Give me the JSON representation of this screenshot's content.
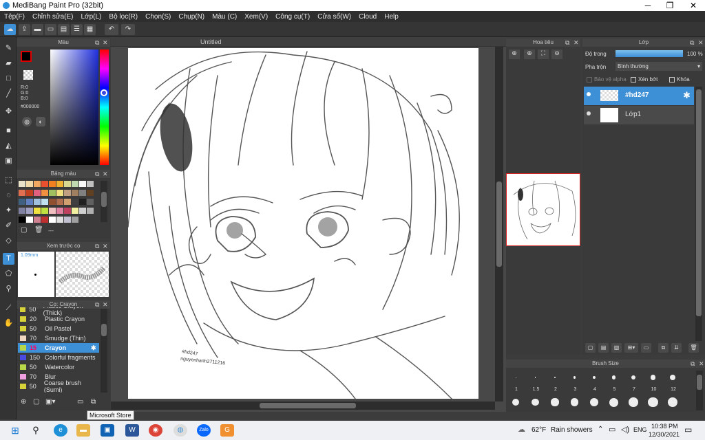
{
  "window": {
    "title": "MediBang Paint Pro (32bit)",
    "minimize": "─",
    "maximize": "❐",
    "close": "✕"
  },
  "menu": [
    "Tệp(F)",
    "Chỉnh sửa(E)",
    "Lớp(L)",
    "Bộ lọc(R)",
    "Chọn(S)",
    "Chụp(N)",
    "Màu (C)",
    "Xem(V)",
    "Công cụ(T)",
    "Cửa sổ(W)",
    "Cloud",
    "Help"
  ],
  "color_panel": {
    "title": "Màu",
    "r": "R:0",
    "g": "G:0",
    "b": "B:0",
    "hex": "#000000",
    "primary": "#000000",
    "accent": "#3d8fd6"
  },
  "palette_panel": {
    "title": "Bảng màu",
    "more": "---"
  },
  "brush_preview": {
    "title": "Xem trước cọ",
    "size": "1.09mm"
  },
  "brush_panel": {
    "title": "Cọ: Crayon",
    "items": [
      {
        "size": "50",
        "name": "Plastic Crayon (Thick)",
        "color": "#d8d23a"
      },
      {
        "size": "20",
        "name": "Plastic Crayon",
        "color": "#d8d23a"
      },
      {
        "size": "50",
        "name": "Oil Pastel",
        "color": "#d8d23a"
      },
      {
        "size": "70",
        "name": "Smudge (Thin)",
        "color": "#f0d8c0"
      },
      {
        "size": "15",
        "name": "Crayon",
        "color": "#b8d84a"
      },
      {
        "size": "150",
        "name": "Colorful fragments",
        "color": "#4a4ae0"
      },
      {
        "size": "50",
        "name": "Watercolor",
        "color": "#b8d84a"
      },
      {
        "size": "70",
        "name": "Blur",
        "color": "#f0a0e0"
      },
      {
        "size": "50",
        "name": "Coarse brush (Sumi)",
        "color": "#d8d23a"
      }
    ]
  },
  "tooltip": "Microsoft Store",
  "document": {
    "title": "Untitled",
    "watermark1": "#hd247",
    "watermark2": "nguyenhanh2711216"
  },
  "navigator": {
    "title": "Hoa tiêu"
  },
  "layer_panel": {
    "title": "Lớp",
    "opacity_label": "Độ trong",
    "opacity_value": "100 %",
    "blend_label": "Pha trộn",
    "blend_value": "Bình thường",
    "protect_alpha": "Bảo vệ alpha",
    "clip": "Xén bớt",
    "lock": "Khóa",
    "layers": [
      {
        "name": "#hd247",
        "selected": true
      },
      {
        "name": "Lớp1",
        "selected": false
      }
    ]
  },
  "brush_size": {
    "title": "Brush Size",
    "small": [
      "1",
      "1.5",
      "2",
      "3",
      "4",
      "5",
      "7",
      "10",
      "12"
    ]
  },
  "taskbar": {
    "weather_temp": "62°F",
    "weather_desc": "Rain showers",
    "lang": "ENG",
    "time": "10:38 PM",
    "date": "12/30/2021"
  }
}
